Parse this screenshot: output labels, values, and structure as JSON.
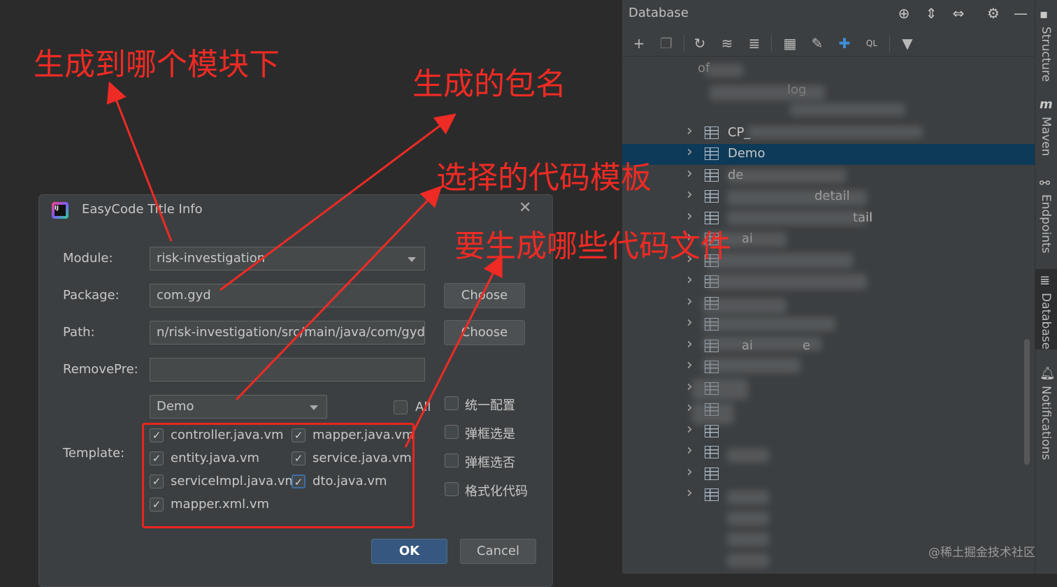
{
  "database_panel": {
    "title": "Database",
    "header_icons": [
      "crosshair-icon",
      "expand-all-icon",
      "collapse-all-icon",
      "gear-icon",
      "minimize-icon"
    ],
    "toolbar_icons": [
      "add-icon",
      "duplicate-icon",
      "refresh-icon",
      "schema-sync-icon",
      "datasource-icon",
      "table-icon",
      "edit-icon",
      "jump-icon",
      "sql-console-icon",
      "filter-icon"
    ],
    "tree_items": [
      {
        "label": "of"
      },
      {
        "label": "log"
      },
      {
        "label": ""
      },
      {
        "label": "CP_"
      },
      {
        "label": "Demo",
        "selected": true
      },
      {
        "label": "de"
      },
      {
        "label": "detail"
      },
      {
        "label": "tail"
      },
      {
        "label": "ai"
      },
      {
        "label": ""
      },
      {
        "label": ""
      },
      {
        "label": ""
      },
      {
        "label": ""
      },
      {
        "label": "ai",
        "suffix": "e"
      },
      {
        "label": ""
      },
      {
        "label": ""
      },
      {
        "label": ""
      },
      {
        "label": ""
      },
      {
        "label": ""
      },
      {
        "label": ""
      },
      {
        "label": ""
      }
    ]
  },
  "side_stripe": {
    "items": [
      "Structure",
      "Maven",
      "Endpoints",
      "Database",
      "Notifications"
    ],
    "active": "Database"
  },
  "dialog": {
    "title": "EasyCode Title Info",
    "logo_text": "IJ",
    "fields": {
      "module_label": "Module:",
      "module_value": "risk-investigation",
      "package_label": "Package:",
      "package_value": "com.gyd",
      "path_label": "Path:",
      "path_value": "n/risk-investigation/src/main/java/com/gyd",
      "removepre_label": "RemovePre:",
      "removepre_value": "",
      "template_label": "Template:"
    },
    "choose_label": "Choose",
    "template_group": "Demo",
    "all_label": "All",
    "all_checked": false,
    "templates": [
      {
        "name": "controller.java.vm",
        "checked": true
      },
      {
        "name": "mapper.java.vm",
        "checked": true
      },
      {
        "name": "entity.java.vm",
        "checked": true
      },
      {
        "name": "service.java.vm",
        "checked": true
      },
      {
        "name": "serviceImpl.java.vm",
        "checked": true
      },
      {
        "name": "dto.java.vm",
        "checked": true
      },
      {
        "name": "mapper.xml.vm",
        "checked": true
      }
    ],
    "options": [
      {
        "label": "统一配置",
        "checked": false
      },
      {
        "label": "弹框选是",
        "checked": false
      },
      {
        "label": "弹框选否",
        "checked": false
      },
      {
        "label": "格式化代码",
        "checked": false
      }
    ],
    "ok_label": "OK",
    "cancel_label": "Cancel"
  },
  "annotations": {
    "module_note": "生成到哪个模块下",
    "package_note": "生成的包名",
    "template_note": "选择的代码模板",
    "files_note": "要生成哪些代码文件",
    "color": "#ee2b24"
  },
  "watermark": "@稀土掘金技术社区"
}
